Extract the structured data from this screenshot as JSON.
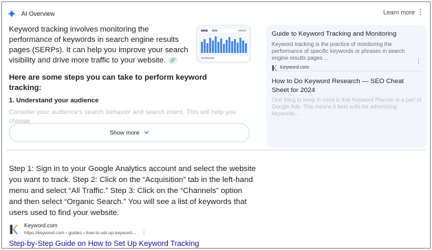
{
  "ai_overview": {
    "title": "AI Overview",
    "learn_more": "Learn more",
    "more_icon": "vertical-dots-icon",
    "summary": "Keyword tracking involves monitoring the performance of keywords in search engine results pages (SERPs). It can help you improve your search visibility and drive more traffic to your website.",
    "steps_heading": "Here are some steps you can take to perform keyword tracking:",
    "step1_heading": "1. Understand your audience",
    "step1_text": "Consider your audience's search behavior and search intent. This will help you choose",
    "show_more": "Show more",
    "accent_color": "#1a73e8"
  },
  "sources": [
    {
      "title": "Guide to Keyword Tracking and Monitoring",
      "snippet": "Keyword tracking is the practice of monitoring the performance of specific keywords or phrases in search engine results pages ...",
      "site": "Keyword.com"
    },
    {
      "title": "How to Do Keyword Research — SEO Cheat Sheet for 2024",
      "snippet": "One thing to keep in mind is that Keyword Planner is a part of Google Ads. This means it best suits for advertising keywords..."
    }
  ],
  "featured_snippet": {
    "text": "Step 1: Sign in to your Google Analytics account and select the website you want to track. Step 2: Click on the “Acquisition” tab in the left-hand menu and select “All Traffic.” Step 3: Click on the “Channels” option and then select “Organic Search.” You will see a list of keywords that users used to find your website.",
    "site_name": "Keyword.com",
    "site_url": "https://keyword.com › guides › how-to-set-up-keyword...",
    "link_title": "Step-by-Step Guide on How to Set Up Keyword Tracking",
    "link_color": "#1a0dab"
  }
}
